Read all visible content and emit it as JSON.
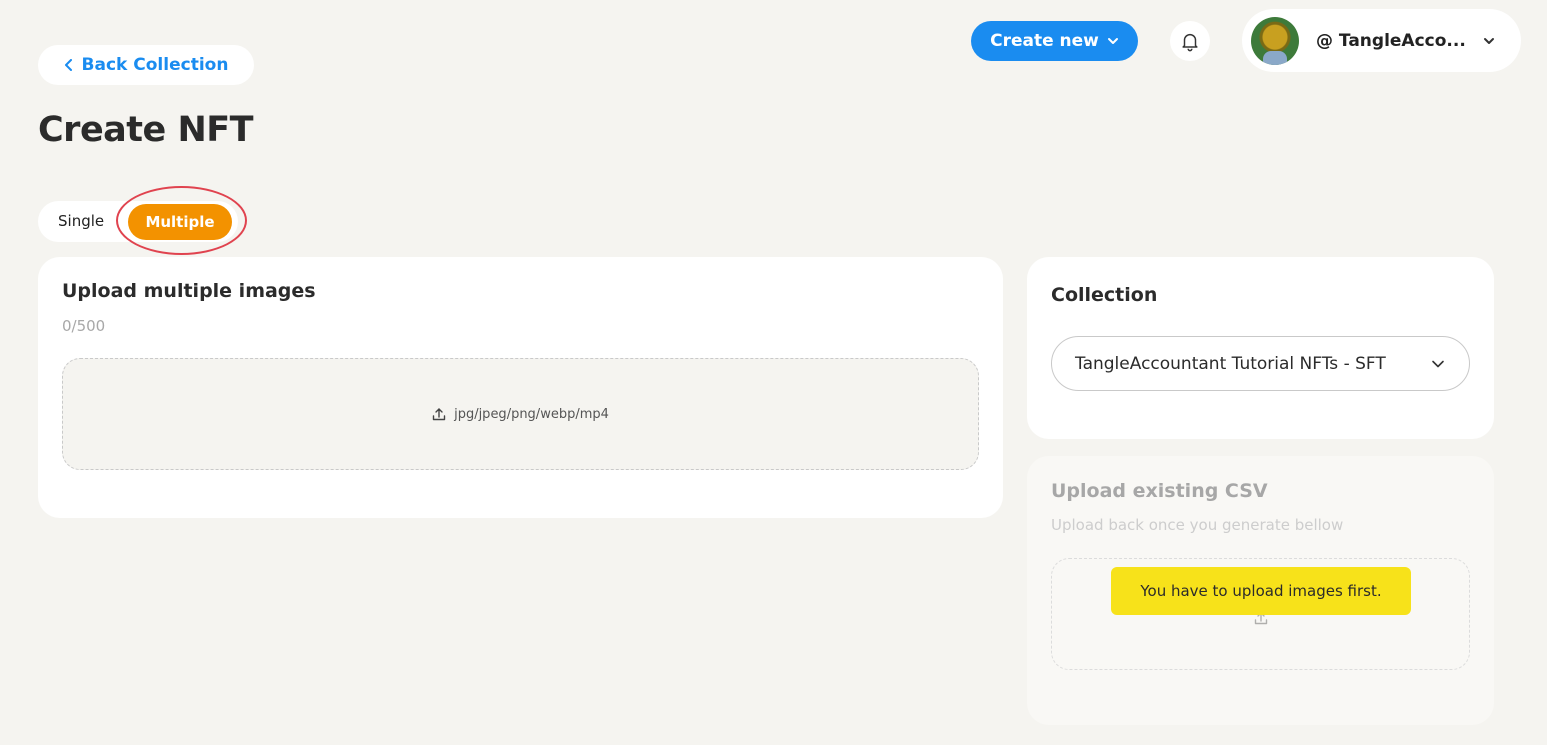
{
  "header": {
    "create_new_label": "Create new",
    "username": "@ TangleAcco..."
  },
  "nav": {
    "back_label": "Back Collection"
  },
  "page": {
    "title": "Create NFT"
  },
  "tabs": {
    "single_label": "Single",
    "multiple_label": "Multiple",
    "active": "Multiple"
  },
  "upload": {
    "title": "Upload multiple images",
    "count": "0/500",
    "formats": "jpg/jpeg/png/webp/mp4"
  },
  "collection": {
    "title": "Collection",
    "selected": "TangleAccountant Tutorial NFTs - SFT"
  },
  "csv": {
    "title": "Upload existing CSV",
    "subtitle": "Upload back once you generate bellow",
    "tooltip": "You have to upload images first."
  },
  "colors": {
    "accent_blue": "#1a8cf0",
    "accent_orange": "#f39200",
    "tooltip_yellow": "#f7e21a",
    "highlight_red": "#e0434f"
  },
  "icons": [
    "chevron-down-icon",
    "bell-icon",
    "chevron-left-icon",
    "upload-icon"
  ]
}
